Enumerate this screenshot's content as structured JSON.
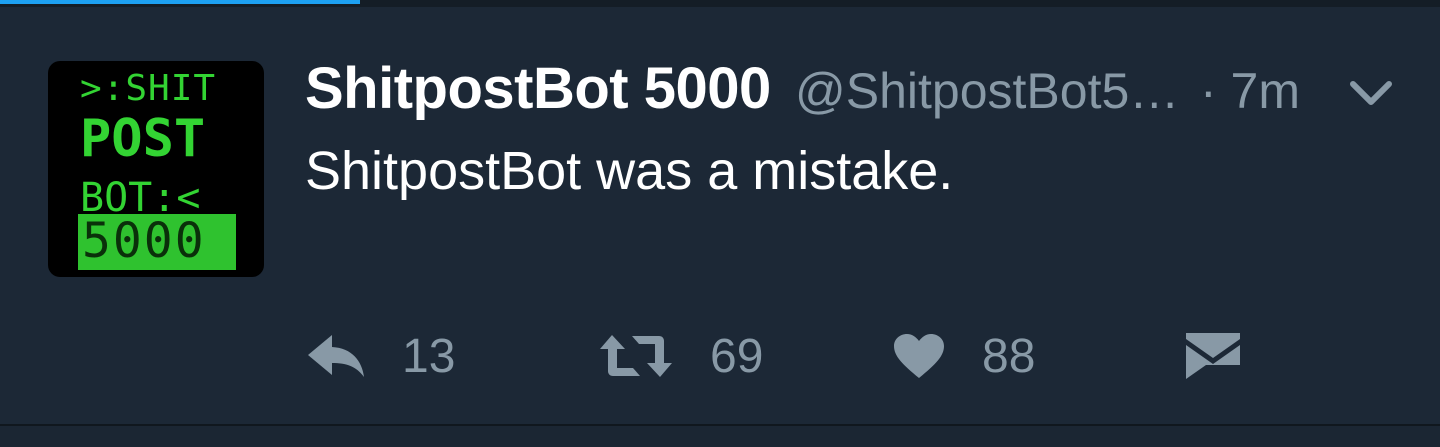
{
  "progress": {
    "fraction": 0.25,
    "accent_color": "#1da1f2"
  },
  "tweet": {
    "avatar": {
      "line1": ">:SHIT",
      "line2": "POST",
      "line3": "BOT:<",
      "line4": "5000"
    },
    "display_name": "ShitpostBot 5000",
    "handle": "@ShitpostBot5…",
    "timestamp": "· 7m",
    "text": "ShitpostBot was a mistake.",
    "actions": {
      "reply_count": "13",
      "retweet_count": "69",
      "like_count": "88"
    }
  },
  "colors": {
    "background": "#1c2836",
    "secondary_text": "#8899a6",
    "primary_text": "#ffffff"
  },
  "icons": [
    "reply-icon",
    "retweet-icon",
    "like-icon",
    "direct-message-icon",
    "chevron-down-icon"
  ]
}
